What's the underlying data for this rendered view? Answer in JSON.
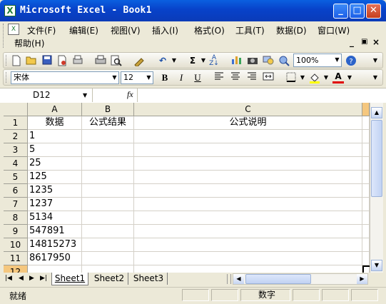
{
  "window": {
    "title": "Microsoft Excel - Book1",
    "app_icon": "X",
    "min_label": "_",
    "max_label": "□",
    "close_label": "✕"
  },
  "menu": {
    "items": [
      "文件(F)",
      "编辑(E)",
      "视图(V)",
      "插入(I)",
      "格式(O)",
      "工具(T)",
      "数据(D)",
      "窗口(W)"
    ],
    "help": "帮助(H)",
    "doc_min": "_",
    "doc_restore": "ð",
    "doc_close": "×"
  },
  "toolbar": {
    "zoom": "100%",
    "sigma": "Σ",
    "font_name": "宋体",
    "font_size": "12",
    "bold": "B",
    "italic": "I",
    "underline": "U",
    "font_color_letter": "A",
    "fx": "fx"
  },
  "formula_bar": {
    "name_box": "D12",
    "formula": ""
  },
  "sheet": {
    "columns": [
      "A",
      "B",
      "C"
    ],
    "rows": [
      "1",
      "2",
      "3",
      "4",
      "5",
      "6",
      "7",
      "8",
      "9",
      "10",
      "11",
      "12"
    ],
    "cells_a": [
      "数据",
      "1",
      "5",
      "25",
      "125",
      "1235",
      "1237",
      "5134",
      "547891",
      "14815273",
      "8617950",
      ""
    ],
    "cells_b": [
      "公式结果",
      "",
      "",
      "",
      "",
      "",
      "",
      "",
      "",
      "",
      "",
      ""
    ],
    "cells_c": [
      "公式说明",
      "",
      "",
      "",
      "",
      "",
      "",
      "",
      "",
      "",
      "",
      ""
    ]
  },
  "tabs": {
    "nav": [
      "|◀",
      "◀",
      "▶",
      "▶|"
    ],
    "sheets": [
      "Sheet1",
      "Sheet2",
      "Sheet3"
    ],
    "active": "Sheet1"
  },
  "status": {
    "ready": "就绪",
    "mode": "数字"
  },
  "colors": {
    "title_bar": "#0842c9",
    "excel_green": "#1e7b34",
    "selection": "#f5c77e"
  }
}
